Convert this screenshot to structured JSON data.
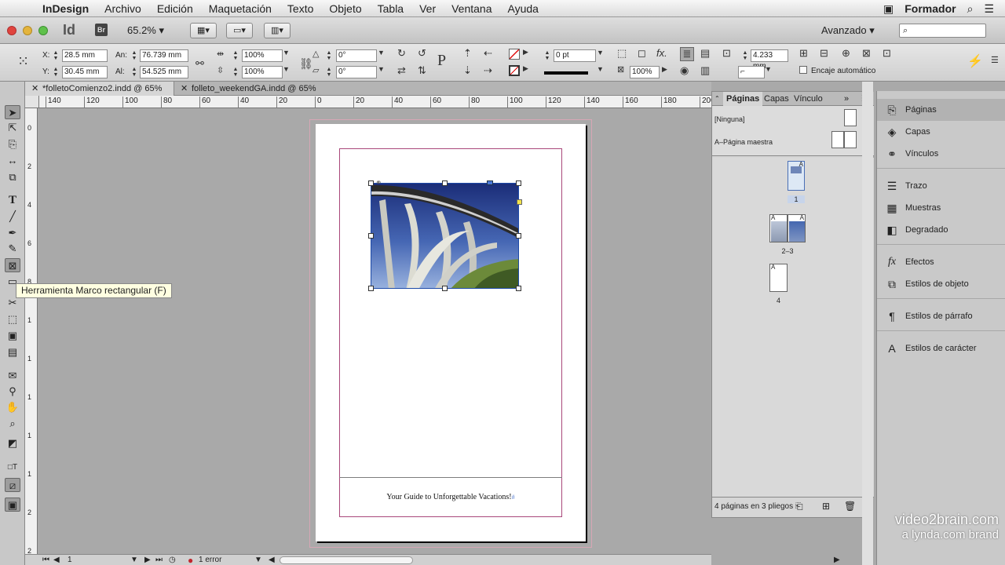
{
  "menubar": {
    "app": "InDesign",
    "items": [
      "Archivo",
      "Edición",
      "Maquetación",
      "Texto",
      "Objeto",
      "Tabla",
      "Ver",
      "Ventana",
      "Ayuda"
    ],
    "user": "Formador"
  },
  "appbar": {
    "logo": "Id",
    "bridge": "Br",
    "zoom": "65.2%",
    "workspace": "Avanzado"
  },
  "control": {
    "x_label": "X:",
    "x_value": "28.5 mm",
    "y_label": "Y:",
    "y_value": "30.45 mm",
    "w_label": "An:",
    "w_value": "76.739 mm",
    "h_label": "Al:",
    "h_value": "54.525 mm",
    "scale_x": "100%",
    "scale_y": "100%",
    "rotate": "0°",
    "shear": "0°",
    "stroke_weight": "0 pt",
    "opacity": "100%",
    "offset": "4.233 mm",
    "autofit_label": "Encaje automático"
  },
  "tabs": [
    {
      "label": "*folletoComienzo2.indd @ 65%",
      "active": true
    },
    {
      "label": "folleto_weekendGA.indd @ 65%",
      "active": false
    }
  ],
  "rulers": {
    "h_ticks": [
      "140",
      "120",
      "100",
      "80",
      "60",
      "40",
      "20",
      "0",
      "20",
      "40",
      "60",
      "80",
      "100",
      "120",
      "140",
      "160",
      "180",
      "200"
    ],
    "v_ticks": [
      "0",
      "2",
      "4",
      "6",
      "8",
      "1",
      "1",
      "1",
      "1",
      "1",
      "2",
      "2",
      "2"
    ]
  },
  "page": {
    "tagline": "Your Guide to Unforgettable Vacations!"
  },
  "tooltip": "Herramienta Marco rectangular (F)",
  "status": {
    "page_number": "1",
    "errors": "1 error"
  },
  "pages_panel": {
    "tabs": [
      "Páginas",
      "Capas",
      "Vínculo"
    ],
    "none_label": "[Ninguna]",
    "master_label": "A–Página maestra",
    "spreads": [
      {
        "label": "1",
        "letter": "A"
      },
      {
        "label": "2–3",
        "letter": "A"
      },
      {
        "label": "4",
        "letter": "A"
      }
    ],
    "footer": "4 páginas en 3 pliegos"
  },
  "dock": {
    "items": [
      {
        "label": "Páginas",
        "icon": "pages-icon"
      },
      {
        "label": "Capas",
        "icon": "layers-icon"
      },
      {
        "label": "Vínculos",
        "icon": "links-icon"
      },
      {
        "label": "Trazo",
        "icon": "stroke-icon"
      },
      {
        "label": "Muestras",
        "icon": "swatches-icon"
      },
      {
        "label": "Degradado",
        "icon": "gradient-icon"
      },
      {
        "label": "Efectos",
        "icon": "effects-icon"
      },
      {
        "label": "Estilos de objeto",
        "icon": "object-styles-icon"
      },
      {
        "label": "Estilos de párrafo",
        "icon": "paragraph-styles-icon"
      },
      {
        "label": "Estilos de carácter",
        "icon": "character-styles-icon"
      }
    ]
  },
  "watermark": {
    "line1": "video2brain.com",
    "line2": "a lynda.com brand"
  },
  "colors": {
    "frame": "#1d4aa8",
    "margin": "#a9477a",
    "bleed": "#d7a6b5",
    "error_dot": "#c0262d"
  }
}
